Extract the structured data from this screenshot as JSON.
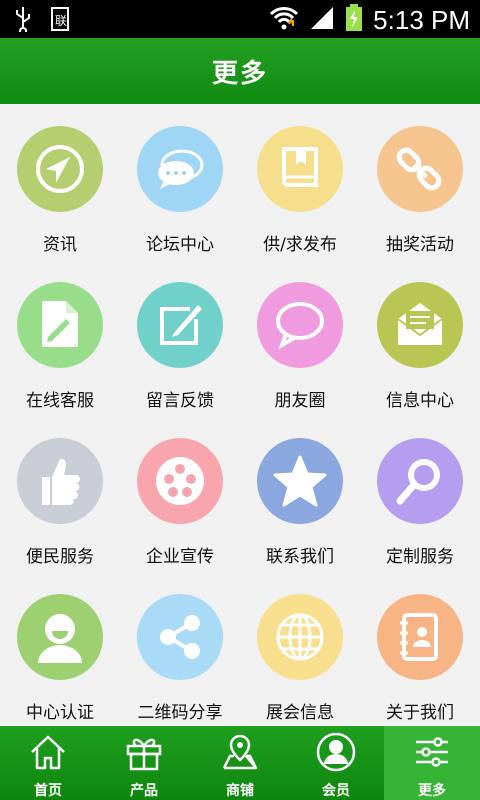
{
  "status_bar": {
    "time": "5:13 PM",
    "icons": [
      "usb-icon",
      "sim-icon",
      "wifi-icon",
      "signal-icon",
      "battery-charging-icon"
    ]
  },
  "header": {
    "title": "更多"
  },
  "grid": {
    "items": [
      {
        "label": "资讯",
        "icon": "compass-icon",
        "color": "#b5cf70"
      },
      {
        "label": "论坛中心",
        "icon": "chat-icon",
        "color": "#9fd6f5"
      },
      {
        "label": "供/求发布",
        "icon": "book-icon",
        "color": "#f6df8c"
      },
      {
        "label": "抽奖活动",
        "icon": "link-icon",
        "color": "#f6c58f"
      },
      {
        "label": "在线客服",
        "icon": "edit-document-icon",
        "color": "#98dd8a"
      },
      {
        "label": "留言反馈",
        "icon": "compose-icon",
        "color": "#6fd1c9"
      },
      {
        "label": "朋友圈",
        "icon": "speech-bubble-icon",
        "color": "#f09be0"
      },
      {
        "label": "信息中心",
        "icon": "mail-icon",
        "color": "#b8c653"
      },
      {
        "label": "便民服务",
        "icon": "thumbs-up-icon",
        "color": "#c8cdd6"
      },
      {
        "label": "企业宣传",
        "icon": "film-reel-icon",
        "color": "#f8a5ae"
      },
      {
        "label": "联系我们",
        "icon": "star-icon",
        "color": "#8ba7e0"
      },
      {
        "label": "定制服务",
        "icon": "magnifier-icon",
        "color": "#b59ef0"
      },
      {
        "label": "中心认证",
        "icon": "user-avatar-icon",
        "color": "#9cd070"
      },
      {
        "label": "二维码分享",
        "icon": "share-icon",
        "color": "#a9daf6"
      },
      {
        "label": "展会信息",
        "icon": "globe-icon",
        "color": "#f8df8e"
      },
      {
        "label": "关于我们",
        "icon": "contacts-book-icon",
        "color": "#f7b585"
      }
    ]
  },
  "tabbar": {
    "tabs": [
      {
        "label": "首页",
        "icon": "home-icon"
      },
      {
        "label": "产品",
        "icon": "gift-icon"
      },
      {
        "label": "商铺",
        "icon": "map-pin-icon"
      },
      {
        "label": "会员",
        "icon": "member-icon"
      },
      {
        "label": "更多",
        "icon": "settings-sliders-icon"
      }
    ],
    "active_index": 4
  }
}
